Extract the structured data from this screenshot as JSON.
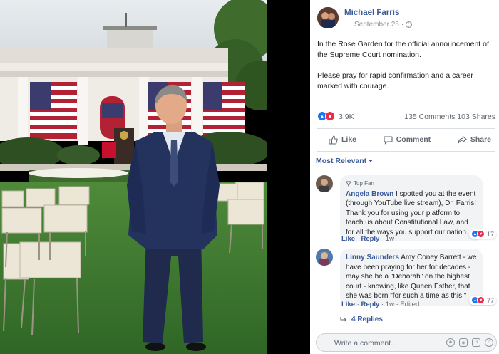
{
  "post": {
    "author": "Michael Farris",
    "date": "September 26",
    "paragraph1": "In the Rose Garden for the official announcement of the Supreme Court nomination.",
    "paragraph2": "Please pray for rapid confirmation and a career marked with courage.",
    "reaction_count": "3.9K",
    "comments_shares": "135 Comments  103 Shares"
  },
  "actions": {
    "like": "Like",
    "comment": "Comment",
    "share": "Share"
  },
  "sort_label": "Most Relevant",
  "comments": [
    {
      "badge": "Top Fan",
      "name": "Angela Brown",
      "text": " I spotted you at the event (through YouTube live stream), Dr. Farris! Thank you for using your platform to teach us about Constitutional Law, and for all the ways you support our nation.",
      "like": "Like",
      "reply": "Reply",
      "time": "1w",
      "reactions": "17"
    },
    {
      "name": "Linny Saunders",
      "text": " Amy Coney Barrett - we have been praying for her for decades - may she be a \"Deborah\" on the highest court - knowing, like Queen Esther, that she was born \"for such a time as this!\"",
      "like": "Like",
      "reply": "Reply",
      "time": "1w",
      "edited": "Edited",
      "reactions": "77"
    }
  ],
  "replies_label": "4 Replies",
  "composer": {
    "placeholder": "Write a comment..."
  },
  "icons": [
    "globe-icon",
    "like-icon",
    "love-icon",
    "thumb-icon",
    "speech-bubble-icon",
    "share-arrow-icon",
    "reply-arrow-icon",
    "emoji-icon",
    "camera-icon",
    "gif-icon",
    "sticker-icon"
  ],
  "colors": {
    "link_blue": "#385898",
    "like_blue": "#1877f2",
    "love_red": "#f0284a",
    "bubble_gray": "#f2f3f5"
  }
}
